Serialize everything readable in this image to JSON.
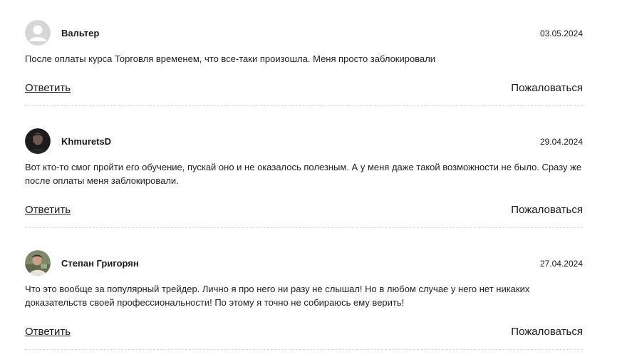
{
  "comments": [
    {
      "author": "Вальтер",
      "date": "03.05.2024",
      "text": "После оплаты курса Торговля временем, что все-таки произошла. Меня просто заблокировали",
      "avatar": "default-user-icon",
      "reply_label": "Ответить",
      "report_label": "Пожаловаться"
    },
    {
      "author": "KhmuretsD",
      "date": "29.04.2024",
      "text": "Вот кто-то смог пройти его обучение, пускай оно и не оказалось полезным. А у меня даже такой возможности не было. Сразу же после оплаты меня заблокировали.",
      "avatar": "user-photo",
      "reply_label": "Ответить",
      "report_label": "Пожаловаться"
    },
    {
      "author": "Степан Григорян",
      "date": "27.04.2024",
      "text": "Что это вообще за популярный трейдер. Лично я про него ни разу не слышал! Но в любом случае у него нет никаких доказательств своей профессиональности! По этому я точно не собираюсь ему верить!",
      "avatar": "user-photo",
      "reply_label": "Ответить",
      "report_label": "Пожаловаться"
    }
  ],
  "colors": {
    "text": "#1a1a1a",
    "divider": "#d9d9d9",
    "default_avatar_bg": "#d6d6d6"
  }
}
